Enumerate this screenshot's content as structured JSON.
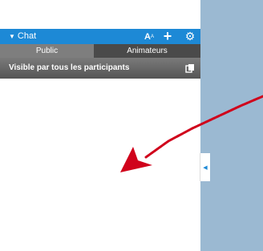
{
  "chat": {
    "title": "Chat",
    "font_label": "A",
    "font_sup": "A",
    "tabs": [
      {
        "label": "Public",
        "active": true
      },
      {
        "label": "Animateurs",
        "active": false
      }
    ],
    "visibility_text": "Visible par tous les participants"
  },
  "icons": {
    "collapse": "chevron-down-icon",
    "font_size": "font-size-icon",
    "add": "plus-icon",
    "settings": "gear-icon",
    "copy": "copy-icon",
    "handle": "chevron-left-icon"
  },
  "colors": {
    "header_blue": "#1d89d6",
    "side_area": "#9bb9d2",
    "arrow_red": "#d0021b"
  }
}
